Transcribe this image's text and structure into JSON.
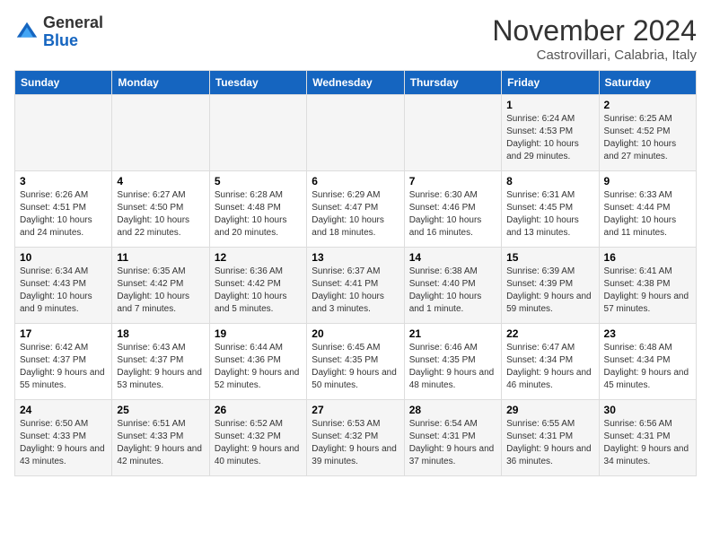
{
  "logo": {
    "general": "General",
    "blue": "Blue"
  },
  "title": "November 2024",
  "subtitle": "Castrovillari, Calabria, Italy",
  "days_of_week": [
    "Sunday",
    "Monday",
    "Tuesday",
    "Wednesday",
    "Thursday",
    "Friday",
    "Saturday"
  ],
  "weeks": [
    [
      {
        "day": "",
        "info": ""
      },
      {
        "day": "",
        "info": ""
      },
      {
        "day": "",
        "info": ""
      },
      {
        "day": "",
        "info": ""
      },
      {
        "day": "",
        "info": ""
      },
      {
        "day": "1",
        "info": "Sunrise: 6:24 AM\nSunset: 4:53 PM\nDaylight: 10 hours and 29 minutes."
      },
      {
        "day": "2",
        "info": "Sunrise: 6:25 AM\nSunset: 4:52 PM\nDaylight: 10 hours and 27 minutes."
      }
    ],
    [
      {
        "day": "3",
        "info": "Sunrise: 6:26 AM\nSunset: 4:51 PM\nDaylight: 10 hours and 24 minutes."
      },
      {
        "day": "4",
        "info": "Sunrise: 6:27 AM\nSunset: 4:50 PM\nDaylight: 10 hours and 22 minutes."
      },
      {
        "day": "5",
        "info": "Sunrise: 6:28 AM\nSunset: 4:48 PM\nDaylight: 10 hours and 20 minutes."
      },
      {
        "day": "6",
        "info": "Sunrise: 6:29 AM\nSunset: 4:47 PM\nDaylight: 10 hours and 18 minutes."
      },
      {
        "day": "7",
        "info": "Sunrise: 6:30 AM\nSunset: 4:46 PM\nDaylight: 10 hours and 16 minutes."
      },
      {
        "day": "8",
        "info": "Sunrise: 6:31 AM\nSunset: 4:45 PM\nDaylight: 10 hours and 13 minutes."
      },
      {
        "day": "9",
        "info": "Sunrise: 6:33 AM\nSunset: 4:44 PM\nDaylight: 10 hours and 11 minutes."
      }
    ],
    [
      {
        "day": "10",
        "info": "Sunrise: 6:34 AM\nSunset: 4:43 PM\nDaylight: 10 hours and 9 minutes."
      },
      {
        "day": "11",
        "info": "Sunrise: 6:35 AM\nSunset: 4:42 PM\nDaylight: 10 hours and 7 minutes."
      },
      {
        "day": "12",
        "info": "Sunrise: 6:36 AM\nSunset: 4:42 PM\nDaylight: 10 hours and 5 minutes."
      },
      {
        "day": "13",
        "info": "Sunrise: 6:37 AM\nSunset: 4:41 PM\nDaylight: 10 hours and 3 minutes."
      },
      {
        "day": "14",
        "info": "Sunrise: 6:38 AM\nSunset: 4:40 PM\nDaylight: 10 hours and 1 minute."
      },
      {
        "day": "15",
        "info": "Sunrise: 6:39 AM\nSunset: 4:39 PM\nDaylight: 9 hours and 59 minutes."
      },
      {
        "day": "16",
        "info": "Sunrise: 6:41 AM\nSunset: 4:38 PM\nDaylight: 9 hours and 57 minutes."
      }
    ],
    [
      {
        "day": "17",
        "info": "Sunrise: 6:42 AM\nSunset: 4:37 PM\nDaylight: 9 hours and 55 minutes."
      },
      {
        "day": "18",
        "info": "Sunrise: 6:43 AM\nSunset: 4:37 PM\nDaylight: 9 hours and 53 minutes."
      },
      {
        "day": "19",
        "info": "Sunrise: 6:44 AM\nSunset: 4:36 PM\nDaylight: 9 hours and 52 minutes."
      },
      {
        "day": "20",
        "info": "Sunrise: 6:45 AM\nSunset: 4:35 PM\nDaylight: 9 hours and 50 minutes."
      },
      {
        "day": "21",
        "info": "Sunrise: 6:46 AM\nSunset: 4:35 PM\nDaylight: 9 hours and 48 minutes."
      },
      {
        "day": "22",
        "info": "Sunrise: 6:47 AM\nSunset: 4:34 PM\nDaylight: 9 hours and 46 minutes."
      },
      {
        "day": "23",
        "info": "Sunrise: 6:48 AM\nSunset: 4:34 PM\nDaylight: 9 hours and 45 minutes."
      }
    ],
    [
      {
        "day": "24",
        "info": "Sunrise: 6:50 AM\nSunset: 4:33 PM\nDaylight: 9 hours and 43 minutes."
      },
      {
        "day": "25",
        "info": "Sunrise: 6:51 AM\nSunset: 4:33 PM\nDaylight: 9 hours and 42 minutes."
      },
      {
        "day": "26",
        "info": "Sunrise: 6:52 AM\nSunset: 4:32 PM\nDaylight: 9 hours and 40 minutes."
      },
      {
        "day": "27",
        "info": "Sunrise: 6:53 AM\nSunset: 4:32 PM\nDaylight: 9 hours and 39 minutes."
      },
      {
        "day": "28",
        "info": "Sunrise: 6:54 AM\nSunset: 4:31 PM\nDaylight: 9 hours and 37 minutes."
      },
      {
        "day": "29",
        "info": "Sunrise: 6:55 AM\nSunset: 4:31 PM\nDaylight: 9 hours and 36 minutes."
      },
      {
        "day": "30",
        "info": "Sunrise: 6:56 AM\nSunset: 4:31 PM\nDaylight: 9 hours and 34 minutes."
      }
    ]
  ]
}
